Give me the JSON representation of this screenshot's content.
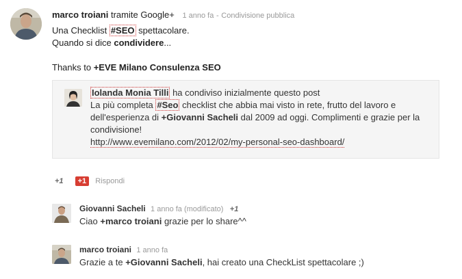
{
  "post": {
    "author": "marco troiani",
    "via": "tramite Google+",
    "time": "1 anno fa",
    "separator": "-",
    "visibility": "Condivisione pubblica",
    "line1_pre": "Una Checklist",
    "line1_tag": "#SEO",
    "line1_post": "spettacolare.",
    "line2_pre": "Quando si dice",
    "line2_bold": "condividere",
    "line2_post": "...",
    "line3_pre": "Thanks to",
    "line3_mention": "+EVE Milano Consulenza SEO"
  },
  "reshare": {
    "author": "Iolanda Monia Tilli",
    "action": "ha condiviso inizialmente questo post",
    "l1_pre": "La più completa",
    "l1_tag": "#Seo",
    "l1_post": "checklist che abbia mai visto in rete, frutto del lavoro e",
    "l2_pre": "dell'esperienza di",
    "l2_mention": "+Giovanni Sacheli",
    "l2_post": "dal 2009 ad oggi. Complimenti e grazie per la",
    "l3": "condivisione!",
    "link": "http://www.evemilano.com/2012/02/my-personal-seo-dashboard/"
  },
  "actions": {
    "plus_one_count": "+1",
    "plus_one_button": "+1",
    "reply": "Rispondi"
  },
  "comments": [
    {
      "author": "Giovanni Sacheli",
      "time": "1 anno fa (modificato)",
      "plus": "+1",
      "pre": "Ciao",
      "mention": "+marco troiani",
      "post": "grazie per lo share^^"
    },
    {
      "author": "marco troiani",
      "time": "1 anno fa",
      "pre": "Grazie a te",
      "mention": "+Giovanni Sacheli",
      "post": ", hai creato una CheckList spettacolare ;)"
    }
  ]
}
